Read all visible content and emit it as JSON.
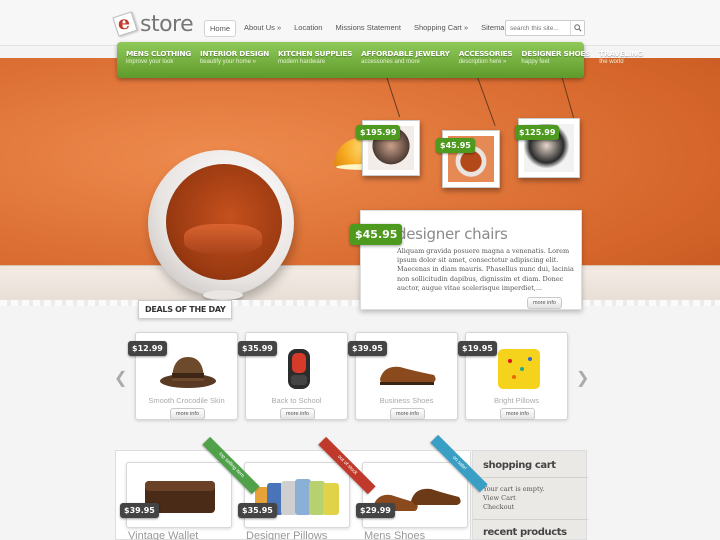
{
  "header": {
    "logo_text": "store",
    "logo_letter": "e",
    "nav": [
      {
        "label": "Home",
        "active": true
      },
      {
        "label": "About Us »",
        "active": false
      },
      {
        "label": "Location",
        "active": false
      },
      {
        "label": "Missions Statement",
        "active": false
      },
      {
        "label": "Shopping Cart »",
        "active": false
      },
      {
        "label": "Sitemap",
        "active": false
      }
    ],
    "search_placeholder": "search this site..."
  },
  "categories": [
    {
      "title": "Mens Clothing",
      "sub": "improve your look"
    },
    {
      "title": "Interior Design",
      "sub": "beautify your home »"
    },
    {
      "title": "Kitchen Supplies",
      "sub": "modern hardware"
    },
    {
      "title": "Affordable Jewelry",
      "sub": "accessories and more"
    },
    {
      "title": "Accessories",
      "sub": "description here »"
    },
    {
      "title": "Designer Shoes",
      "sub": "happy feet"
    },
    {
      "title": "Traveling",
      "sub": "the world"
    }
  ],
  "hero": {
    "frames": [
      {
        "price": "$195.99"
      },
      {
        "price": "$45.95"
      },
      {
        "price": "$125.99"
      }
    ],
    "feature": {
      "price": "$45.95",
      "title": "designer chairs",
      "body": "Aliquam gravida posuere magna a venenatis. Lorem ipsum dolor sit amet, consectetur adipiscing elit. Maecenas in diam mauris. Phasellus nunc dui, lacinia non sollicitudin dapibus, dignissim et diam. Donec auctor, augue vitae scelerisque imperdiet,...",
      "more": "more info"
    }
  },
  "deals": {
    "label": "Deals of the Day",
    "items": [
      {
        "price": "$12.99",
        "name": "Smooth Crocodile Skin",
        "more": "more info"
      },
      {
        "price": "$35.99",
        "name": "Back to School",
        "more": "more info"
      },
      {
        "price": "$39.95",
        "name": "Business Shoes",
        "more": "more info"
      },
      {
        "price": "$19.95",
        "name": "Bright Pillows",
        "more": "more info"
      }
    ]
  },
  "products": [
    {
      "price": "$39.95",
      "name": "Vintage Wallet",
      "ribbon": "top selling item",
      "ribbon_color": "#4fa24a"
    },
    {
      "price": "$35.95",
      "name": "Designer Pillows",
      "ribbon": "out of stock",
      "ribbon_color": "#c0392b"
    },
    {
      "price": "$29.99",
      "name": "Mens Shoes",
      "ribbon": "on sale!",
      "ribbon_color": "#3a9fc4"
    }
  ],
  "sidebar": {
    "cart_title": "shopping cart",
    "cart_lines": [
      "Your cart is empty.",
      "View Cart",
      "Checkout"
    ],
    "recent_title": "recent products"
  },
  "colors": {
    "accent_green": "#5e9a2b",
    "hero_orange": "#d5652a",
    "price_dark": "#444444"
  }
}
